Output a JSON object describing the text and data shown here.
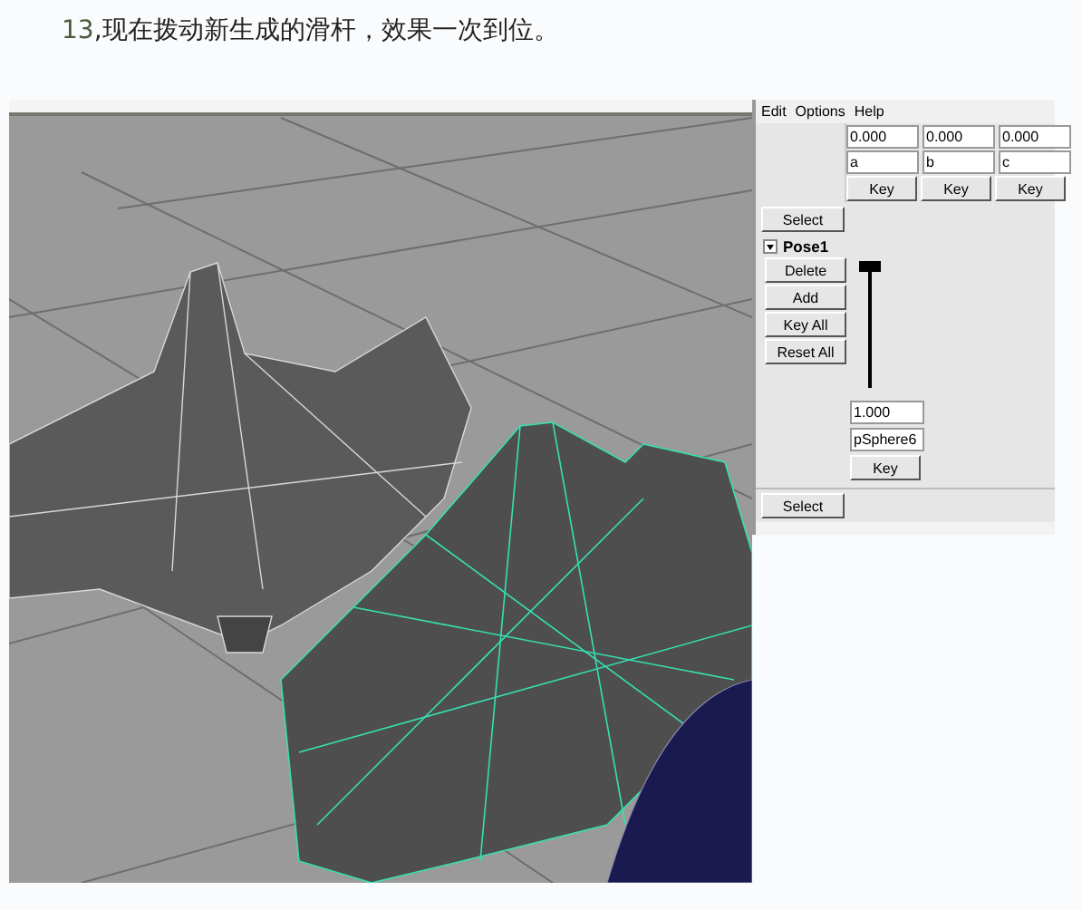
{
  "caption": {
    "number": "13",
    "text": ",现在拨动新生成的滑杆，效果一次到位。"
  },
  "editor": {
    "menu": [
      "Edit",
      "Options",
      "Help"
    ],
    "targets": [
      {
        "value": "0.000",
        "name": "a",
        "key": "Key"
      },
      {
        "value": "0.000",
        "name": "b",
        "key": "Key"
      },
      {
        "value": "0.000",
        "name": "c",
        "key": "Key"
      }
    ],
    "select_top": "Select",
    "pose": {
      "name": "Pose1",
      "expanded": true,
      "buttons": [
        "Delete",
        "Add",
        "Key All",
        "Reset All"
      ],
      "slider": {
        "level": 1,
        "value": "1.000",
        "target": "pSphere6",
        "key": "Key"
      }
    },
    "select_bottom": "Select"
  }
}
